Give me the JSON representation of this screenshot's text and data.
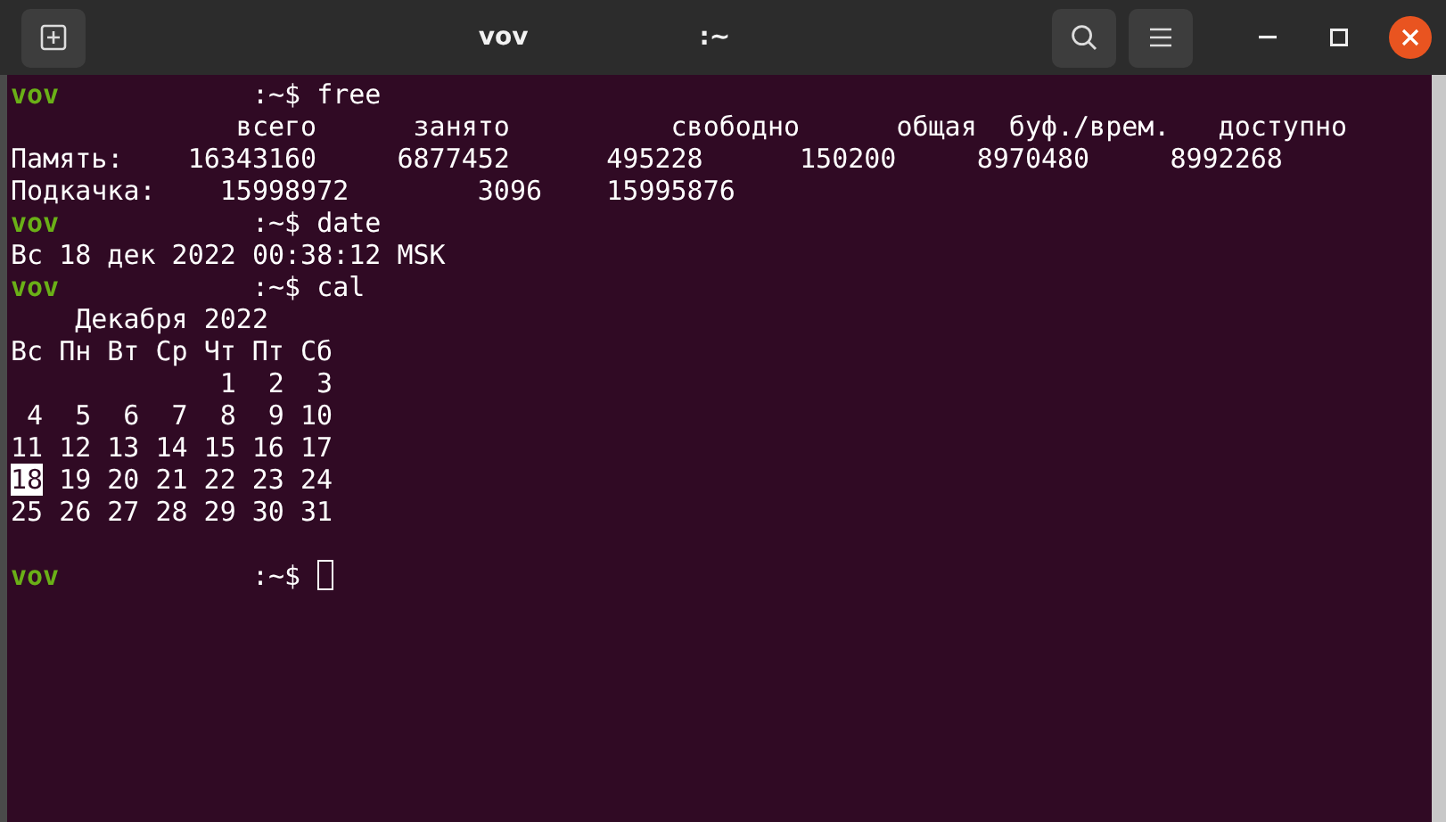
{
  "window": {
    "title_user": "vov",
    "title_path": ":~"
  },
  "lines": [
    {
      "kind": "prompt",
      "user": "vov",
      "path": ":~$",
      "command": "free"
    },
    {
      "kind": "output",
      "text": "              всего      занято          свободно      общая  буф./врем.   доступно"
    },
    {
      "kind": "output",
      "text": "Память:    16343160     6877452      495228      150200     8970480     8992268"
    },
    {
      "kind": "output",
      "text": "Подкачка:    15998972        3096    15995876"
    },
    {
      "kind": "prompt",
      "user": "vov",
      "path": ":~$",
      "command": "date"
    },
    {
      "kind": "output",
      "text": "Вс 18 дек 2022 00:38:12 MSK"
    },
    {
      "kind": "prompt",
      "user": "vov",
      "path": ":~$",
      "command": "cal"
    },
    {
      "kind": "calendar",
      "title": "    Декабря 2022",
      "weekdays": [
        "Вс",
        "Пн",
        "Вт",
        "Ср",
        "Чт",
        "Пт",
        "Сб"
      ],
      "weeks": [
        [
          {
            "day": "1",
            "selected": false
          },
          {
            "day": "2",
            "selected": false
          },
          {
            "day": "3",
            "selected": false
          }
        ],
        [
          {
            "day": "4",
            "selected": false
          },
          {
            "day": "5",
            "selected": false
          },
          {
            "day": "6",
            "selected": false
          },
          {
            "day": "7",
            "selected": false
          },
          {
            "day": "8",
            "selected": false
          },
          {
            "day": "9",
            "selected": false
          },
          {
            "day": "10",
            "selected": false
          }
        ],
        [
          {
            "day": "11",
            "selected": false
          },
          {
            "day": "12",
            "selected": false
          },
          {
            "day": "13",
            "selected": false
          },
          {
            "day": "14",
            "selected": false
          },
          {
            "day": "15",
            "selected": false
          },
          {
            "day": "16",
            "selected": false
          },
          {
            "day": "17",
            "selected": false
          }
        ],
        [
          {
            "day": "18",
            "selected": true
          },
          {
            "day": "19",
            "selected": false
          },
          {
            "day": "20",
            "selected": false
          },
          {
            "day": "21",
            "selected": false
          },
          {
            "day": "22",
            "selected": false
          },
          {
            "day": "23",
            "selected": false
          },
          {
            "day": "24",
            "selected": false
          }
        ],
        [
          {
            "day": "25",
            "selected": false
          },
          {
            "day": "26",
            "selected": false
          },
          {
            "day": "27",
            "selected": false
          },
          {
            "day": "28",
            "selected": false
          },
          {
            "day": "29",
            "selected": false
          },
          {
            "day": "30",
            "selected": false
          },
          {
            "day": "31",
            "selected": false
          }
        ]
      ]
    },
    {
      "kind": "blank"
    },
    {
      "kind": "prompt",
      "user": "vov",
      "path": ":~$",
      "cursor": true
    }
  ]
}
